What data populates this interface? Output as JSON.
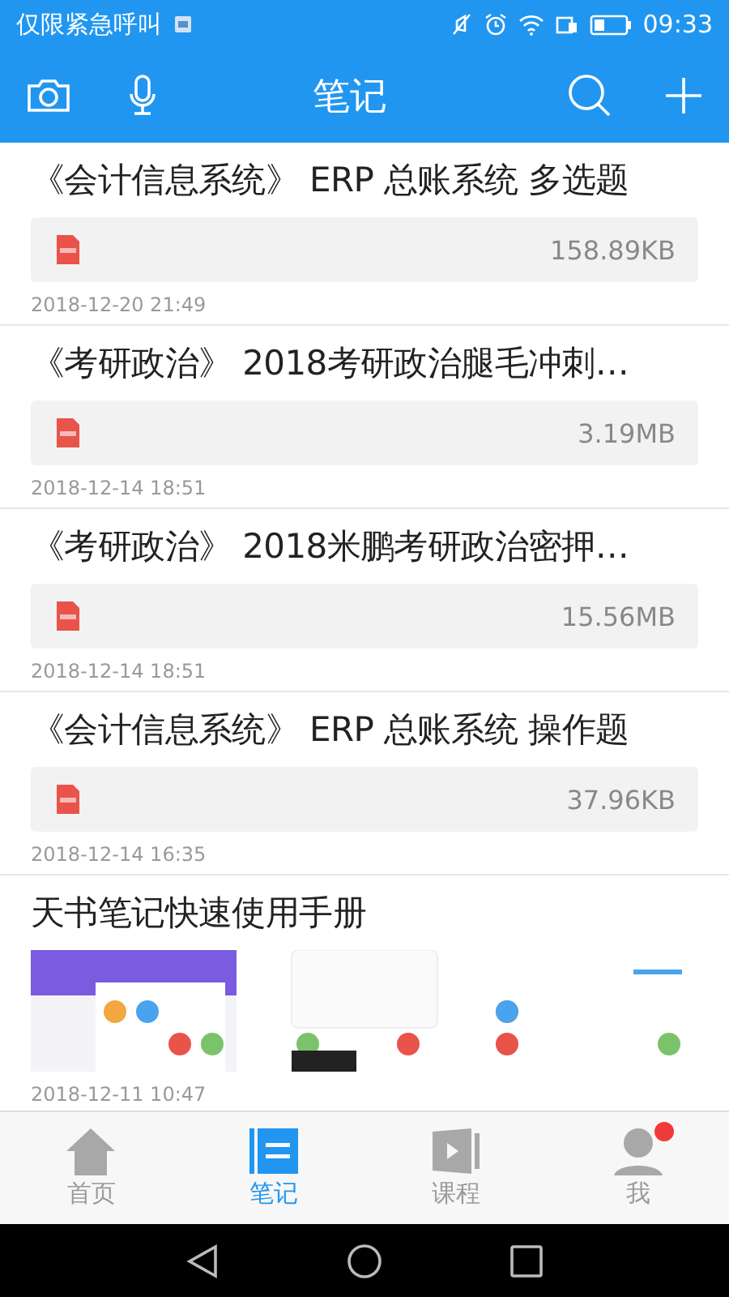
{
  "status_bar": {
    "carrier": "仅限紧急呼叫",
    "time": "09:33"
  },
  "header": {
    "title": "笔记"
  },
  "notes": [
    {
      "kind": "file",
      "title": "《会计信息系统》 ERP 总账系统 多选题",
      "size": "158.89KB",
      "date": "2018-12-20 21:49"
    },
    {
      "kind": "file",
      "title": "《考研政治》 2018考研政治腿毛冲刺…",
      "size": "3.19MB",
      "date": "2018-12-14 18:51"
    },
    {
      "kind": "file",
      "title": "《考研政治》 2018米鹏考研政治密押…",
      "size": "15.56MB",
      "date": "2018-12-14 18:51"
    },
    {
      "kind": "file",
      "title": "《会计信息系统》 ERP 总账系统 操作题",
      "size": "37.96KB",
      "date": "2018-12-14 16:35"
    },
    {
      "kind": "images",
      "title": "天书笔记快速使用手册",
      "date": "2018-12-11 10:47"
    }
  ],
  "tabs": [
    {
      "label": "首页",
      "selected": false,
      "dot": false
    },
    {
      "label": "笔记",
      "selected": true,
      "dot": false
    },
    {
      "label": "课程",
      "selected": false,
      "dot": false
    },
    {
      "label": "我",
      "selected": false,
      "dot": true
    }
  ]
}
